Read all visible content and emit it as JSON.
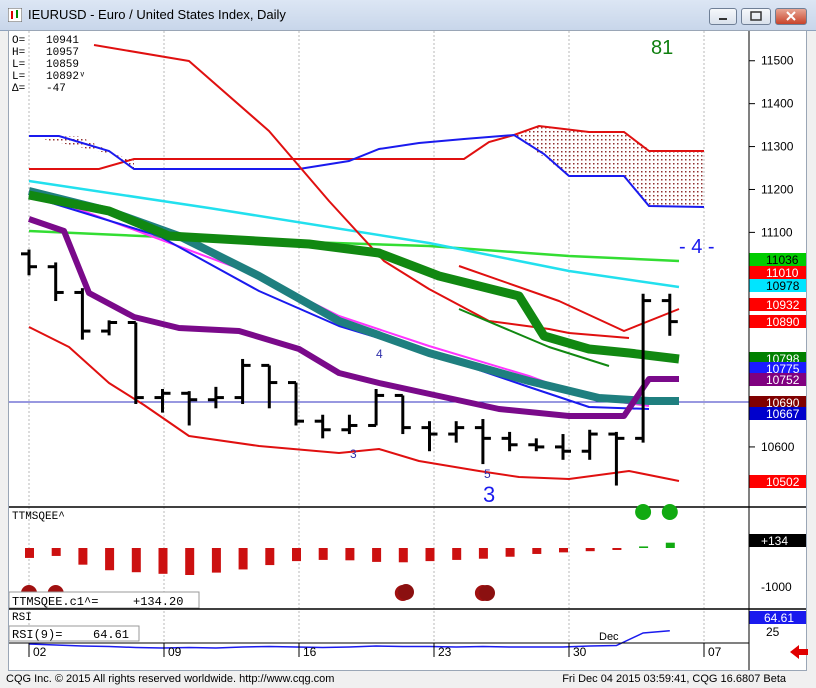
{
  "window": {
    "title": "IEURUSD - Euro / United States Index, Daily",
    "minimize_icon": "minimize-icon",
    "maximize_icon": "maximize-icon",
    "close_icon": "close-icon"
  },
  "ohlc_box": {
    "rows": [
      {
        "label": "O=",
        "value": "10941"
      },
      {
        "label": "H=",
        "value": "10957"
      },
      {
        "label": "L=",
        "value": "10859"
      },
      {
        "label": "L=",
        "value": "10892ᵛ"
      },
      {
        "label": "Δ=",
        "value": "-47"
      }
    ]
  },
  "annotations": {
    "top_count": "81",
    "wave_4_big": "- 4 -",
    "wave_3_big": "3",
    "small_4": "4",
    "small_3": "3",
    "small_5": "5",
    "dec_label": "Dec"
  },
  "price_axis": {
    "ticks": [
      "11500",
      "11400",
      "11300",
      "11200",
      "11100",
      "10600"
    ],
    "labels": [
      {
        "value": "11036",
        "bg": "#00cc00",
        "fg": "#000000"
      },
      {
        "value": "11010",
        "bg": "#ff0000",
        "fg": "#ffffff"
      },
      {
        "value": "10978",
        "bg": "#00e5ff",
        "fg": "#000000"
      },
      {
        "value": "10932",
        "bg": "#ff0000",
        "fg": "#ffffff"
      },
      {
        "value": "10890",
        "bg": "#ff0000",
        "fg": "#ffffff"
      },
      {
        "value": "10798",
        "bg": "#008000",
        "fg": "#ffffff"
      },
      {
        "value": "10775",
        "bg": "#1a1aff",
        "fg": "#ffffff"
      },
      {
        "value": "10752",
        "bg": "#800080",
        "fg": "#ffffff"
      },
      {
        "value": "10690",
        "bg": "#800000",
        "fg": "#ffffff"
      },
      {
        "value": "10667",
        "bg": "#0000cc",
        "fg": "#ffffff"
      },
      {
        "value": "10502",
        "bg": "#ff0000",
        "fg": "#ffffff"
      }
    ]
  },
  "ttm_panel": {
    "title": "TTMSQEE^",
    "value_label": "+134",
    "tick_label": "-1000",
    "readout_name": "TTMSQEE.c1^=",
    "readout_value": "+134.20"
  },
  "rsi_panel": {
    "title": "RSI",
    "readout_name": "RSI(9)=",
    "readout_value": "64.61",
    "value_label": "64.61",
    "tick_label": "25"
  },
  "date_axis": {
    "labels": [
      "02",
      "09",
      "16",
      "23",
      "30",
      "07"
    ]
  },
  "footer": {
    "left": "CQG Inc. © 2015 All rights reserved worldwide. http://www.cqg.com",
    "right": "Fri Dec 04 2015 03:59:41, CQG 16.6807 Beta"
  },
  "chart_data": [
    {
      "type": "bar",
      "title": "IEURUSD - Euro / United States Index, Daily",
      "subtype": "ohlc",
      "x": [
        "Nov 02",
        "Nov 03",
        "Nov 04",
        "Nov 05",
        "Nov 06",
        "Nov 09",
        "Nov 10",
        "Nov 11",
        "Nov 12",
        "Nov 13",
        "Nov 16",
        "Nov 17",
        "Nov 18",
        "Nov 19",
        "Nov 20",
        "Nov 23",
        "Nov 24",
        "Nov 25",
        "Nov 26",
        "Nov 27",
        "Nov 30",
        "Dec 01",
        "Dec 02",
        "Dec 03",
        "Dec 04"
      ],
      "ohlc": [
        [
          11050,
          11060,
          11000,
          11020
        ],
        [
          11020,
          11030,
          10940,
          10960
        ],
        [
          10960,
          10970,
          10850,
          10870
        ],
        [
          10870,
          10895,
          10860,
          10890
        ],
        [
          10890,
          10890,
          10700,
          10715
        ],
        [
          10715,
          10735,
          10680,
          10725
        ],
        [
          10725,
          10730,
          10650,
          10710
        ],
        [
          10710,
          10740,
          10690,
          10715
        ],
        [
          10715,
          10805,
          10700,
          10790
        ],
        [
          10790,
          10790,
          10690,
          10750
        ],
        [
          10750,
          10750,
          10650,
          10660
        ],
        [
          10660,
          10675,
          10620,
          10640
        ],
        [
          10640,
          10675,
          10630,
          10650
        ],
        [
          10650,
          10735,
          10650,
          10720
        ],
        [
          10720,
          10720,
          10630,
          10645
        ],
        [
          10645,
          10660,
          10590,
          10630
        ],
        [
          10630,
          10660,
          10610,
          10645
        ],
        [
          10645,
          10665,
          10560,
          10620
        ],
        [
          10620,
          10635,
          10590,
          10605
        ],
        [
          10605,
          10620,
          10590,
          10600
        ],
        [
          10600,
          10630,
          10570,
          10590
        ],
        [
          10590,
          10640,
          10570,
          10630
        ],
        [
          10630,
          10635,
          10510,
          10620
        ],
        [
          10620,
          10957,
          10610,
          10941
        ],
        [
          10941,
          10957,
          10859,
          10892
        ]
      ],
      "ylim": [
        10460,
        11560
      ],
      "series": [
        {
          "name": "11036",
          "color": "#00cc00"
        },
        {
          "name": "11010",
          "color": "#ff0000"
        },
        {
          "name": "10978",
          "color": "#00e5ff"
        },
        {
          "name": "10932",
          "color": "#ff0000"
        },
        {
          "name": "10890",
          "color": "#ff0000"
        },
        {
          "name": "10798",
          "color": "#008000"
        },
        {
          "name": "10775",
          "color": "#1a1aff"
        },
        {
          "name": "10752",
          "color": "#800080"
        },
        {
          "name": "10690",
          "color": "#800000"
        },
        {
          "name": "10667",
          "color": "#0000cc"
        },
        {
          "name": "10502",
          "color": "#ff0000"
        }
      ]
    },
    {
      "type": "bar",
      "title": "TTMSQEE^",
      "values": [
        -250,
        -200,
        -420,
        -560,
        -610,
        -650,
        -680,
        -620,
        -540,
        -430,
        -330,
        -300,
        -310,
        -350,
        -360,
        -330,
        -300,
        -270,
        -220,
        -150,
        -110,
        -80,
        -50,
        40,
        134
      ],
      "dots": {
        "red_days": [
          0,
          1,
          14,
          17
        ],
        "green_days": [
          23,
          24
        ]
      }
    },
    {
      "type": "line",
      "title": "RSI(9)",
      "values": [
        38,
        36,
        34,
        33,
        31,
        30,
        31,
        30,
        32,
        33,
        32,
        31,
        32,
        34,
        33,
        33,
        32,
        33,
        32,
        32,
        32,
        34,
        35,
        60,
        64.61
      ]
    }
  ]
}
